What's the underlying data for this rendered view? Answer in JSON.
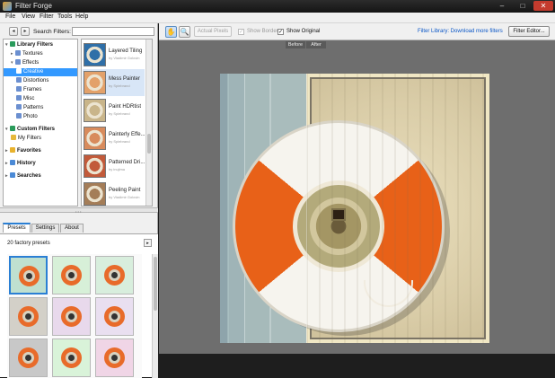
{
  "window": {
    "title": "Filter Forge",
    "controls": {
      "minimize": "–",
      "maximize": "□",
      "close": "✕"
    }
  },
  "menu": [
    "File",
    "View",
    "Filter",
    "Tools",
    "Help"
  ],
  "search": {
    "label": "Search Filters:",
    "value": ""
  },
  "tree": [
    {
      "label": "Library Filters",
      "bold": true,
      "icon_color": "#2a9b5b",
      "expander": "▾"
    },
    {
      "label": "Textures",
      "icon_color": "#6b8fd0",
      "expander": "▸"
    },
    {
      "label": "Effects",
      "icon_color": "#6b8fd0",
      "expander": "▾"
    },
    {
      "label": "Creative",
      "icon_color": "#ffffff",
      "selected": true
    },
    {
      "label": "Distortions",
      "icon_color": "#6b8fd0"
    },
    {
      "label": "Frames",
      "icon_color": "#6b8fd0"
    },
    {
      "label": "Misc",
      "icon_color": "#6b8fd0"
    },
    {
      "label": "Patterns",
      "icon_color": "#6b8fd0"
    },
    {
      "label": "Photo",
      "icon_color": "#6b8fd0"
    },
    {
      "label": "Custom Filters",
      "bold": true,
      "icon_color": "#2a9b5b",
      "expander": "▾"
    },
    {
      "label": "My Filters",
      "icon_color": "#e6b83a"
    },
    {
      "label": "Favorites",
      "bold": true,
      "icon_color": "#e8b22d",
      "expander": "▸"
    },
    {
      "label": "History",
      "bold": true,
      "icon_color": "#4b8ad6",
      "expander": "▸"
    },
    {
      "label": "Searches",
      "bold": true,
      "icon_color": "#4b8ad6",
      "expander": "▸"
    }
  ],
  "filters": [
    {
      "name": "Layered Tiling",
      "author": "by Vladimir Golovin",
      "thumb": "#2f6fa8"
    },
    {
      "name": "Mess Painter",
      "author": "by Spiebrand",
      "thumb": "#e3a16a",
      "selected": true
    },
    {
      "name": "Paint HDRtist",
      "author": "by Spiebrand",
      "thumb": "#c9b58a"
    },
    {
      "name": "Painterly Effe...",
      "author": "by Spiebrand",
      "thumb": "#d88b5c"
    },
    {
      "name": "Patterned Dri...",
      "author": "by inujima",
      "thumb": "#c25a3a"
    },
    {
      "name": "Peeling Paint",
      "author": "by Vladimir Golovin",
      "thumb": "#a47d58"
    }
  ],
  "tabs": [
    "Presets",
    "Settings",
    "About"
  ],
  "presets": {
    "header": "20 factory presets",
    "next": "▸",
    "swatches": [
      "#bfe0d0",
      "#d7f0d8",
      "#d8eedd",
      "#d3d0c8",
      "#e8d9ec",
      "#e9dff0",
      "#c8c8c8",
      "#d9f3d9",
      "#f0d5e6"
    ]
  },
  "toolbar": {
    "hand_icon": "✋",
    "zoom_icon": "🔍",
    "actual_pixels": "Actual Pixels",
    "show_border": "Show Border",
    "show_original": "Show Original",
    "check_mark": "✓",
    "library_link": "Filter Library: Download more filters",
    "filter_editor": "Filter Editor..."
  },
  "preview": {
    "before": "Before",
    "after": "After"
  },
  "nav": {
    "back": "◂",
    "forward": "▸"
  },
  "colors": {
    "accent": "#2a7fd4",
    "selection": "#3399ff",
    "link": "#0b57c7",
    "buoy_orange": "#e86118"
  }
}
